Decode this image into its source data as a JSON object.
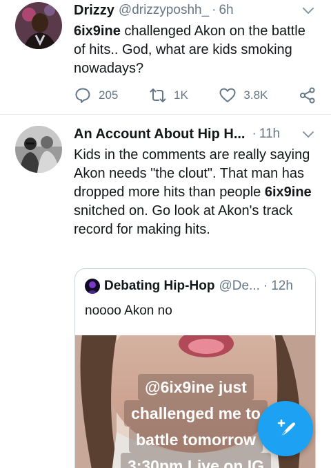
{
  "tweets": [
    {
      "name": "Drizzy",
      "handle": "@drizzyposhh_",
      "dot": "·",
      "time": "6h",
      "text_bold": "6ix9ine",
      "text_rest": " challenged Akon on the battle of hits.. God, what are kids smoking nowadays?",
      "replies": "205",
      "retweets": "1K",
      "likes": "3.8K"
    },
    {
      "name": "An Account About Hip H...",
      "dot": "·",
      "time": "11h",
      "text_pre": "Kids in the comments are really saying Akon needs \"the clout\". That man has dropped more hits than people ",
      "text_bold": "6ix9ine",
      "text_post": " snitched on. Go look at Akon's track record for making hits."
    }
  ],
  "quote": {
    "name": "Debating Hip-Hop",
    "handle": "@De...",
    "dot": "·",
    "time": "12h",
    "text": "noooo Akon no",
    "media_lines": [
      "@6ix9ine just",
      "challenged me to",
      "battle tomorrow",
      "3:30pm Live on IG"
    ]
  },
  "icons": {
    "reply": "reply-icon",
    "retweet": "retweet-icon",
    "like": "heart-icon",
    "share": "share-icon",
    "caret": "chevron-down-icon",
    "compose": "compose-icon"
  },
  "colors": {
    "accent": "#1da1f2",
    "muted": "#657786",
    "text": "#14171a",
    "border": "#e6ecf0"
  }
}
